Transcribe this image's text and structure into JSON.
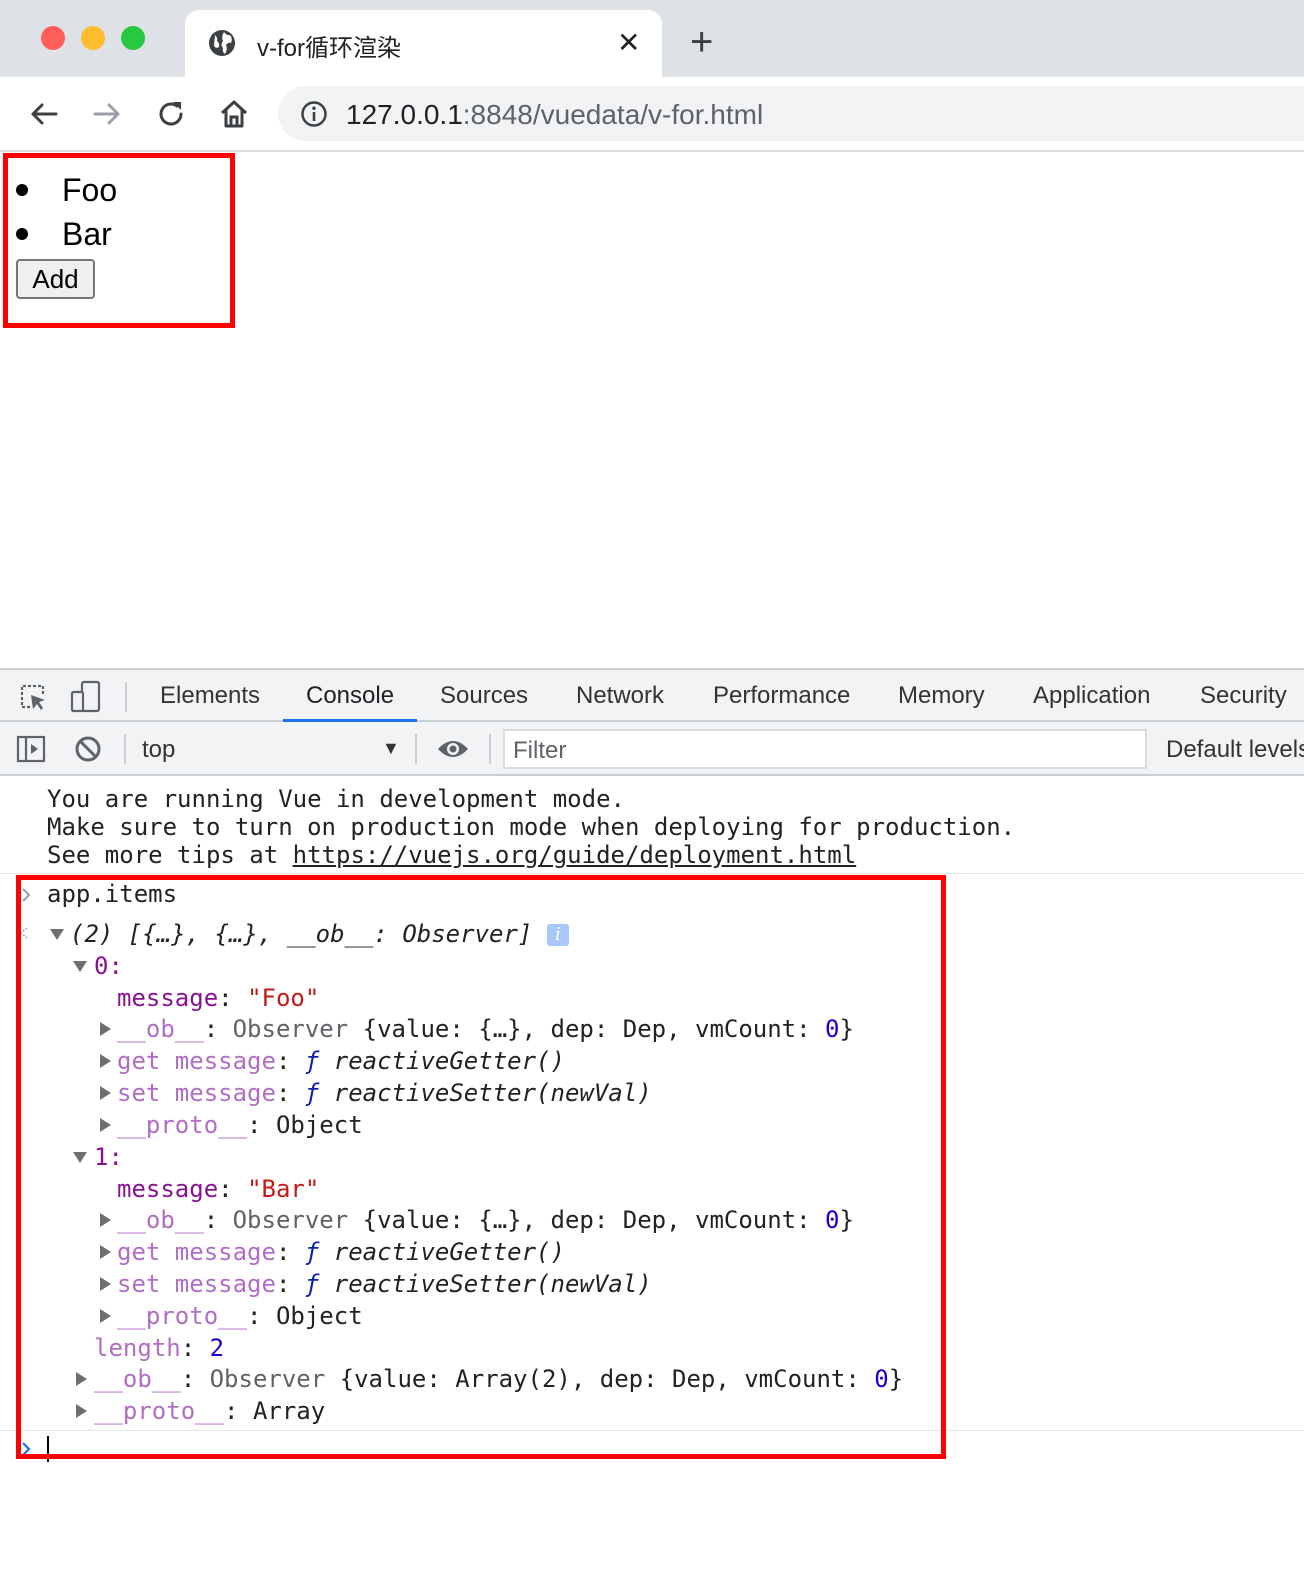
{
  "browser": {
    "tab_title": "v-for循环渲染",
    "tab_close": "✕",
    "new_tab": "+",
    "url_host": "127.0.0.1",
    "url_rest": ":8848/vuedata/v-for.html"
  },
  "page": {
    "items": [
      "Foo",
      "Bar"
    ],
    "add_button": "Add"
  },
  "devtools": {
    "tabs": [
      "Elements",
      "Console",
      "Sources",
      "Network",
      "Performance",
      "Memory",
      "Application",
      "Security"
    ],
    "active_tab": "Console",
    "context": "top",
    "filter_placeholder": "Filter",
    "levels": "Default levels"
  },
  "console": {
    "warn_line1": "You are running Vue in development mode.",
    "warn_line2": "Make sure to turn on production mode when deploying for production.",
    "warn_line3_prefix": "See more tips at ",
    "warn_link": "https://vuejs.org/guide/deployment.html",
    "input": "app.items",
    "result_summary": "(2) [{…}, {…}, __ob__: Observer]",
    "info_badge": "i",
    "items": [
      {
        "index": "0:",
        "message_key": "message",
        "message_value": "\"Foo\"",
        "ob_key": "__ob__",
        "ob_value_a": "Observer ",
        "ob_value_b": "{value: {…}, dep: Dep, vmCount: ",
        "ob_value_num": "0",
        "ob_value_end": "}",
        "getter_key": "get message",
        "getter_f": "ƒ",
        "getter_value": "reactiveGetter()",
        "setter_key": "set message",
        "setter_f": "ƒ",
        "setter_value": "reactiveSetter(newVal)",
        "proto_key": "__proto__",
        "proto_value": "Object"
      },
      {
        "index": "1:",
        "message_key": "message",
        "message_value": "\"Bar\"",
        "ob_key": "__ob__",
        "ob_value_a": "Observer ",
        "ob_value_b": "{value: {…}, dep: Dep, vmCount: ",
        "ob_value_num": "0",
        "ob_value_end": "}",
        "getter_key": "get message",
        "getter_f": "ƒ",
        "getter_value": "reactiveGetter()",
        "setter_key": "set message",
        "setter_f": "ƒ",
        "setter_value": "reactiveSetter(newVal)",
        "proto_key": "__proto__",
        "proto_value": "Object"
      }
    ],
    "length_key": "length",
    "length_value": "2",
    "arr_ob_key": "__ob__",
    "arr_ob_value_a": "Observer ",
    "arr_ob_value_b": "{value: Array(2), dep: Dep, vmCount: ",
    "arr_ob_num": "0",
    "arr_ob_end": "}",
    "arr_proto_key": "__proto__",
    "arr_proto_value": "Array"
  },
  "colors": {
    "highlight": "#ff0000",
    "active_tab_underline": "#1a73e8"
  }
}
